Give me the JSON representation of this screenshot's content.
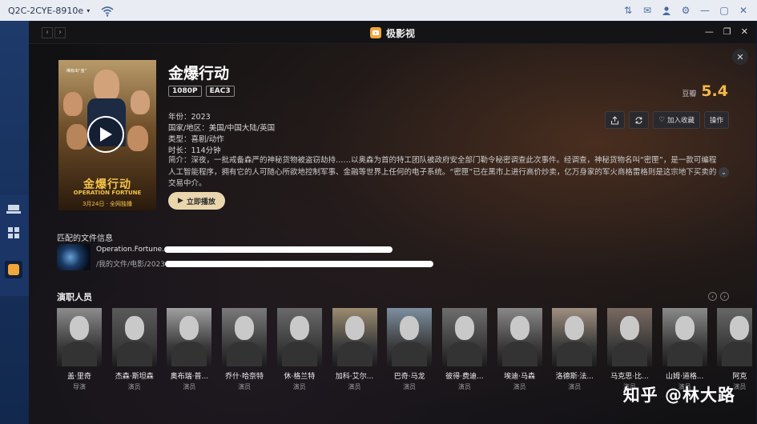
{
  "system": {
    "host_label": "Q2C-2CYE-8910e",
    "icons": [
      "wifi-icon",
      "transfer-icon",
      "message-icon",
      "user-icon",
      "settings-icon",
      "minimize-icon",
      "maximize-icon",
      "close-icon"
    ]
  },
  "window": {
    "app_title": "极影视",
    "back_icon": "‹",
    "forward_icon": "›",
    "min_icon": "—",
    "max_icon": "❐",
    "close_icon": "✕"
  },
  "poster": {
    "title": "金爆行动",
    "subtitle": "OPERATION FORTUNE",
    "date": "3月24日 · 全网独播",
    "tagline": "稀有出“金”"
  },
  "movie": {
    "title": "金爆行动",
    "tags": [
      "1080P",
      "EAC3"
    ],
    "rating_label": "豆瓣",
    "rating_value": "5.4",
    "year": "年份：2023",
    "region": "国家/地区：美国/中国大陆/英国",
    "genre": "类型：喜剧/动作",
    "duration": "时长：114分钟",
    "synopsis": "简介：深夜，一批戒备森严的神秘货物被盗窃劫持……以奥森为首的特工团队被政府安全部门勒令秘密调查此次事件。经调查，神秘货物名叫“密匣”，是一款可编程人工智能程序，拥有它的人可随心所欲地控制军事、金融等世界上任何的电子系统。“密匣”已在黑市上进行高价炒卖，亿万身家的军火商格雷格则是这宗地下买卖的交易中介。",
    "play_label": "立即播放",
    "actions": {
      "share_icon": "share-icon",
      "refresh_icon": "refresh-icon",
      "favorite_label": "加入收藏",
      "operate_label": "操作"
    }
  },
  "file": {
    "section_title": "匹配的文件信息",
    "name_prefix": "Operation.Fortune.",
    "path_prefix": "/我的文件/电影/2023"
  },
  "cast": {
    "section_title": "演职人员",
    "members": [
      {
        "name": "盖·里奇",
        "role": "导演"
      },
      {
        "name": "杰森·斯坦森",
        "role": "演员"
      },
      {
        "name": "奥布瑞·普...",
        "role": "演员"
      },
      {
        "name": "乔什·哈奈特",
        "role": "演员"
      },
      {
        "name": "休·格兰特",
        "role": "演员"
      },
      {
        "name": "加科·艾尔...",
        "role": "演员"
      },
      {
        "name": "巴奇·马龙",
        "role": "演员"
      },
      {
        "name": "彼得·费迪...",
        "role": "演员"
      },
      {
        "name": "埃迪·马森",
        "role": "演员"
      },
      {
        "name": "洛德斯·法...",
        "role": "演员"
      },
      {
        "name": "马克思·比...",
        "role": "演员"
      },
      {
        "name": "山姆·道格...",
        "role": "演员"
      },
      {
        "name": "阿克",
        "role": "演员"
      }
    ]
  },
  "watermark": "知乎 @林大路"
}
